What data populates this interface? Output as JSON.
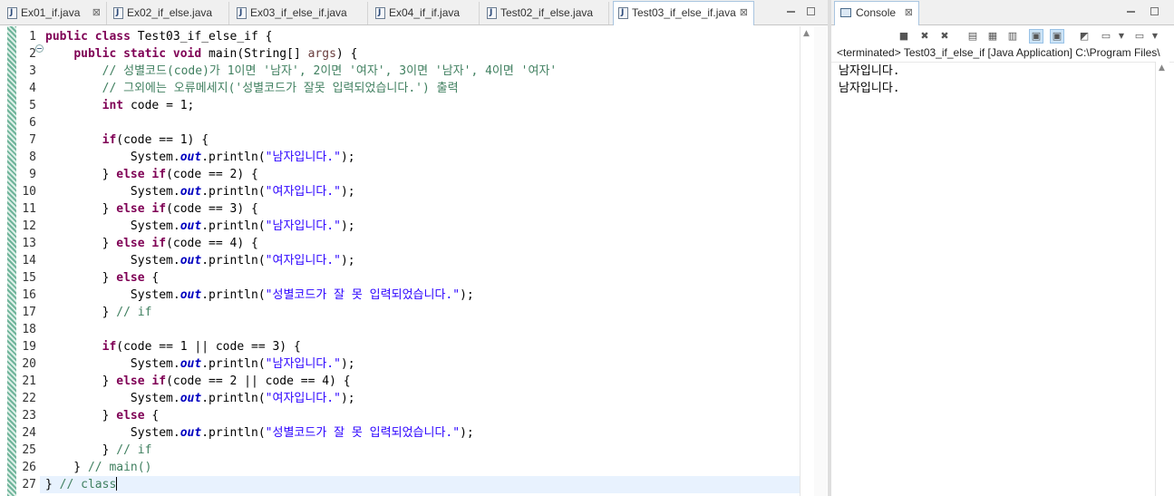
{
  "editor": {
    "tabs": [
      {
        "label": "Ex01_if.java",
        "active": false,
        "close": "⊠"
      },
      {
        "label": "Ex02_if_else.java",
        "active": false
      },
      {
        "label": "Ex03_if_else_if.java",
        "active": false
      },
      {
        "label": "Ex04_if_if.java",
        "active": false
      },
      {
        "label": "Test02_if_else.java",
        "active": false
      },
      {
        "label": "Test03_if_else_if.java",
        "active": true,
        "close": "⊠"
      }
    ],
    "line_numbers": [
      "1",
      "2",
      "3",
      "4",
      "5",
      "6",
      "7",
      "8",
      "9",
      "10",
      "11",
      "12",
      "13",
      "14",
      "15",
      "16",
      "17",
      "18",
      "19",
      "20",
      "21",
      "22",
      "23",
      "24",
      "25",
      "26",
      "27"
    ],
    "fold_marker_line": "2",
    "current_line": "27",
    "code_lines": [
      [
        {
          "c": "kw",
          "t": "public class "
        },
        {
          "c": "",
          "t": "Test03_if_else_if {"
        }
      ],
      [
        {
          "c": "",
          "t": "    "
        },
        {
          "c": "kw",
          "t": "public static void "
        },
        {
          "c": "",
          "t": "main(String[] "
        },
        {
          "c": "pm",
          "t": "args"
        },
        {
          "c": "",
          "t": ") {"
        }
      ],
      [
        {
          "c": "",
          "t": "        "
        },
        {
          "c": "cm",
          "t": "// 성별코드(code)가 1이면 '남자', 2이면 '여자', 3이면 '남자', 4이면 '여자'"
        }
      ],
      [
        {
          "c": "",
          "t": "        "
        },
        {
          "c": "cm",
          "t": "// 그외에는 오류메세지('성별코드가 잘못 입력되었습니다.') 출력"
        }
      ],
      [
        {
          "c": "",
          "t": "        "
        },
        {
          "c": "kw",
          "t": "int "
        },
        {
          "c": "",
          "t": "code = 1;"
        }
      ],
      [
        {
          "c": "",
          "t": ""
        }
      ],
      [
        {
          "c": "",
          "t": "        "
        },
        {
          "c": "kw",
          "t": "if"
        },
        {
          "c": "",
          "t": "(code == 1) {"
        }
      ],
      [
        {
          "c": "",
          "t": "            System."
        },
        {
          "c": "fld",
          "t": "out"
        },
        {
          "c": "",
          "t": ".println("
        },
        {
          "c": "str",
          "t": "\"남자입니다.\""
        },
        {
          "c": "",
          "t": ");"
        }
      ],
      [
        {
          "c": "",
          "t": "        } "
        },
        {
          "c": "kw",
          "t": "else if"
        },
        {
          "c": "",
          "t": "(code == 2) {"
        }
      ],
      [
        {
          "c": "",
          "t": "            System."
        },
        {
          "c": "fld",
          "t": "out"
        },
        {
          "c": "",
          "t": ".println("
        },
        {
          "c": "str",
          "t": "\"여자입니다.\""
        },
        {
          "c": "",
          "t": ");"
        }
      ],
      [
        {
          "c": "",
          "t": "        } "
        },
        {
          "c": "kw",
          "t": "else if"
        },
        {
          "c": "",
          "t": "(code == 3) {"
        }
      ],
      [
        {
          "c": "",
          "t": "            System."
        },
        {
          "c": "fld",
          "t": "out"
        },
        {
          "c": "",
          "t": ".println("
        },
        {
          "c": "str",
          "t": "\"남자입니다.\""
        },
        {
          "c": "",
          "t": ");"
        }
      ],
      [
        {
          "c": "",
          "t": "        } "
        },
        {
          "c": "kw",
          "t": "else if"
        },
        {
          "c": "",
          "t": "(code == 4) {"
        }
      ],
      [
        {
          "c": "",
          "t": "            System."
        },
        {
          "c": "fld",
          "t": "out"
        },
        {
          "c": "",
          "t": ".println("
        },
        {
          "c": "str",
          "t": "\"여자입니다.\""
        },
        {
          "c": "",
          "t": ");"
        }
      ],
      [
        {
          "c": "",
          "t": "        } "
        },
        {
          "c": "kw",
          "t": "else "
        },
        {
          "c": "",
          "t": "{"
        }
      ],
      [
        {
          "c": "",
          "t": "            System."
        },
        {
          "c": "fld",
          "t": "out"
        },
        {
          "c": "",
          "t": ".println("
        },
        {
          "c": "str",
          "t": "\"성별코드가 잘 못 입력되었습니다.\""
        },
        {
          "c": "",
          "t": ");"
        }
      ],
      [
        {
          "c": "",
          "t": "        } "
        },
        {
          "c": "cm",
          "t": "// if"
        }
      ],
      [
        {
          "c": "",
          "t": ""
        }
      ],
      [
        {
          "c": "",
          "t": "        "
        },
        {
          "c": "kw",
          "t": "if"
        },
        {
          "c": "",
          "t": "(code == 1 || code == 3) {"
        }
      ],
      [
        {
          "c": "",
          "t": "            System."
        },
        {
          "c": "fld",
          "t": "out"
        },
        {
          "c": "",
          "t": ".println("
        },
        {
          "c": "str",
          "t": "\"남자입니다.\""
        },
        {
          "c": "",
          "t": ");"
        }
      ],
      [
        {
          "c": "",
          "t": "        } "
        },
        {
          "c": "kw",
          "t": "else if"
        },
        {
          "c": "",
          "t": "(code == 2 || code == 4) {"
        }
      ],
      [
        {
          "c": "",
          "t": "            System."
        },
        {
          "c": "fld",
          "t": "out"
        },
        {
          "c": "",
          "t": ".println("
        },
        {
          "c": "str",
          "t": "\"여자입니다.\""
        },
        {
          "c": "",
          "t": ");"
        }
      ],
      [
        {
          "c": "",
          "t": "        } "
        },
        {
          "c": "kw",
          "t": "else "
        },
        {
          "c": "",
          "t": "{"
        }
      ],
      [
        {
          "c": "",
          "t": "            System."
        },
        {
          "c": "fld",
          "t": "out"
        },
        {
          "c": "",
          "t": ".println("
        },
        {
          "c": "str",
          "t": "\"성별코드가 잘 못 입력되었습니다.\""
        },
        {
          "c": "",
          "t": ");"
        }
      ],
      [
        {
          "c": "",
          "t": "        } "
        },
        {
          "c": "cm",
          "t": "// if"
        }
      ],
      [
        {
          "c": "",
          "t": "    } "
        },
        {
          "c": "cm",
          "t": "// main()"
        }
      ],
      [
        {
          "c": "",
          "t": "} "
        },
        {
          "c": "cm",
          "t": "// class"
        }
      ]
    ]
  },
  "console": {
    "tab_label": "Console",
    "tab_close": "⊠",
    "status": "<terminated> Test03_if_else_if [Java Application] C:\\Program Files\\",
    "output": [
      "남자입니다.",
      "남자입니다."
    ]
  },
  "icons": {
    "java-file": "java-file-icon",
    "console": "console-icon",
    "minimize": "minimize-icon",
    "maximize": "maximize-icon"
  },
  "colors": {
    "keyword": "#7f0055",
    "string": "#2a00ff",
    "comment": "#3f7f5f",
    "field": "#0000c0",
    "current_line": "#e8f2fe",
    "active_tab_border": "#a9c5e0"
  }
}
